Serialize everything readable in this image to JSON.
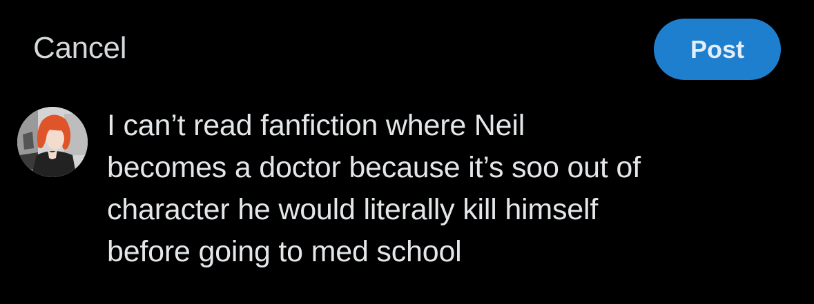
{
  "header": {
    "cancel_label": "Cancel",
    "post_label": "Post"
  },
  "composer": {
    "avatar_icon": "user-avatar-photo",
    "text": "I can’t read fanfiction where Neil\nbecomes a doctor because it’s soo out of\ncharacter he would literally kill himself\nbefore going to med school"
  },
  "colors": {
    "background": "#000000",
    "post_button": "#1f7fcf",
    "text": "#e4e7e9",
    "cancel_text": "#d6d9db"
  }
}
